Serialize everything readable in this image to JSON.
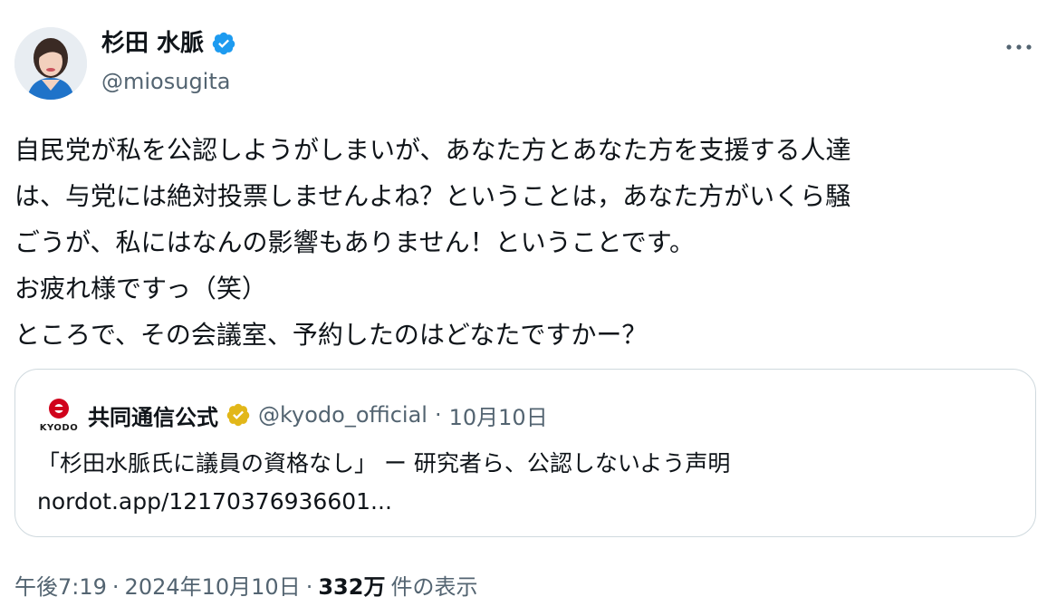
{
  "author": {
    "name": "杉田 水脈",
    "handle": "@miosugita",
    "verified_color": "#1d9bf0"
  },
  "tweet": {
    "lines": [
      "自民党が私を公認しようがしまいが、あなた方とあなた方を支援する人達",
      "は、与党には絶対投票しませんよね？ということは，あなた方がいくら騒",
      "ごうが、私にはなんの影響もありません！ということです。",
      "お疲れ様ですっ（笑）",
      "ところで、その会議室、予約したのはどなたですかー？"
    ]
  },
  "quote": {
    "logo_text": "KYODO",
    "logo_color": "#d0021b",
    "name": "共同通信公式",
    "verified_color": "#e2b719",
    "handle": "@kyodo_official",
    "separator": "·",
    "date": "10月10日",
    "headline": "「杉田水脈氏に議員の資格なし」 ー 研究者ら、公認しないよう声明",
    "link": "nordot.app/12170376936601..."
  },
  "meta": {
    "time": "午後7:19",
    "sep1": "·",
    "date": "2024年10月10日",
    "sep2": "·",
    "views_count": "332万",
    "views_label": "件の表示"
  },
  "icons": {
    "verified": "verified-badge-icon",
    "more": "more-options-icon"
  }
}
